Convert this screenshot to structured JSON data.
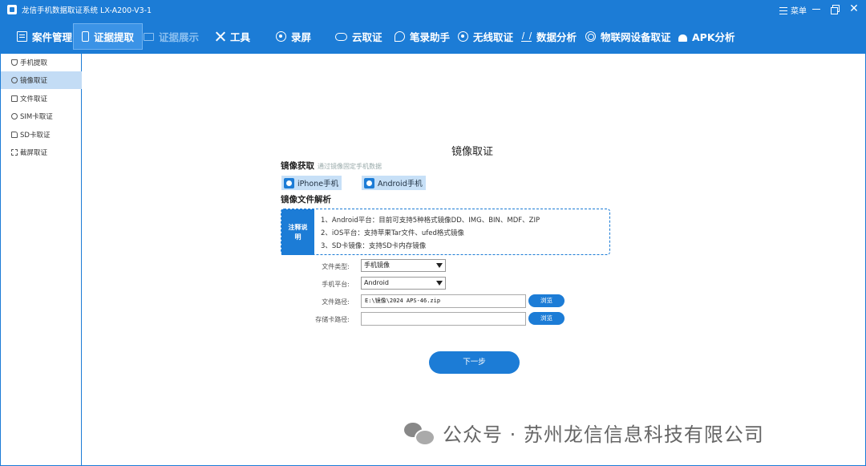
{
  "window": {
    "title": "龙信手机数据取证系统 LX-A200-V3-1",
    "menu_label": "菜单",
    "close_glyph": "✕"
  },
  "nav": {
    "items": [
      {
        "label": "案件管理",
        "icon": "case-icon",
        "state": "normal"
      },
      {
        "label": "证据提取",
        "icon": "phone-icon",
        "state": "active"
      },
      {
        "label": "证据展示",
        "icon": "screen-icon",
        "state": "disabled"
      },
      {
        "label": "工具",
        "icon": "tools-icon",
        "state": "normal"
      },
      {
        "label": "录屏",
        "icon": "record-icon",
        "state": "normal"
      },
      {
        "label": "云取证",
        "icon": "cloud-icon",
        "state": "normal"
      },
      {
        "label": "笔录助手",
        "icon": "pen-icon",
        "state": "normal"
      },
      {
        "label": "无线取证",
        "icon": "wifi-icon",
        "state": "normal"
      },
      {
        "label": "数据分析",
        "icon": "chart-icon",
        "state": "normal"
      },
      {
        "label": "物联网设备取证",
        "icon": "iot-icon",
        "state": "normal"
      },
      {
        "label": "APK分析",
        "icon": "android-icon",
        "state": "normal"
      }
    ]
  },
  "sidebar": {
    "items": [
      {
        "label": "手机提取",
        "icon": "shield-icon",
        "active": false
      },
      {
        "label": "镜像取证",
        "icon": "search-icon",
        "active": true
      },
      {
        "label": "文件取证",
        "icon": "files-icon",
        "active": false
      },
      {
        "label": "SIM卡取证",
        "icon": "sim-search-icon",
        "active": false
      },
      {
        "label": "SD卡取证",
        "icon": "sd-card-icon",
        "active": false
      },
      {
        "label": "截屏取证",
        "icon": "screenshot-icon",
        "active": false
      }
    ]
  },
  "main": {
    "title": "镜像取证",
    "acquire_section": {
      "title": "镜像获取",
      "hint": "通过镜像固定手机数据",
      "iphone_label": "iPhone手机",
      "android_label": "Android手机"
    },
    "parse_section": {
      "title": "镜像文件解析"
    },
    "notes": {
      "label": "注释说明",
      "lines": [
        "1、Android平台：目前可支持5种格式镜像DD、IMG、BIN、MDF、ZIP",
        "2、iOS平台：支持苹果Tar文件、ufed格式镜像",
        "3、SD卡镜像：支持SD卡内存镜像"
      ]
    },
    "form": {
      "file_type_label": "文件类型:",
      "file_type_value": "手机镜像",
      "platform_label": "手机平台:",
      "platform_value": "Android",
      "file_path_label": "文件路径:",
      "file_path_value": "E:\\镜像\\2024 APS-46.zip",
      "storage_path_label": "存储卡路径:",
      "storage_path_value": "",
      "browse_label": "浏览"
    },
    "next_label": "下一步"
  },
  "watermark": {
    "text": "公众号 · 苏州龙信信息科技有限公司"
  },
  "colors": {
    "brand_blue": "#1c7cd6",
    "active_sidebar": "#c3dcf5",
    "platform_button": "#c7e0f7"
  }
}
